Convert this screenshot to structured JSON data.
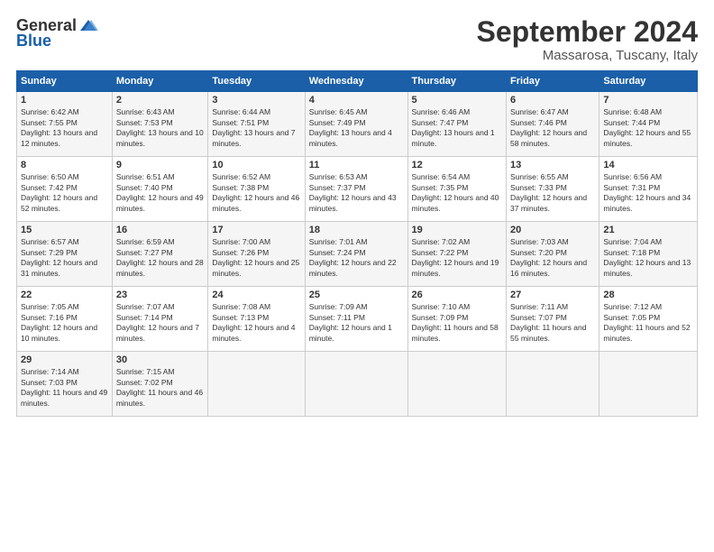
{
  "header": {
    "logo_general": "General",
    "logo_blue": "Blue",
    "month_title": "September 2024",
    "location": "Massarosa, Tuscany, Italy"
  },
  "columns": [
    "Sunday",
    "Monday",
    "Tuesday",
    "Wednesday",
    "Thursday",
    "Friday",
    "Saturday"
  ],
  "weeks": [
    [
      {
        "day": "1",
        "sunrise": "Sunrise: 6:42 AM",
        "sunset": "Sunset: 7:55 PM",
        "daylight": "Daylight: 13 hours and 12 minutes."
      },
      {
        "day": "2",
        "sunrise": "Sunrise: 6:43 AM",
        "sunset": "Sunset: 7:53 PM",
        "daylight": "Daylight: 13 hours and 10 minutes."
      },
      {
        "day": "3",
        "sunrise": "Sunrise: 6:44 AM",
        "sunset": "Sunset: 7:51 PM",
        "daylight": "Daylight: 13 hours and 7 minutes."
      },
      {
        "day": "4",
        "sunrise": "Sunrise: 6:45 AM",
        "sunset": "Sunset: 7:49 PM",
        "daylight": "Daylight: 13 hours and 4 minutes."
      },
      {
        "day": "5",
        "sunrise": "Sunrise: 6:46 AM",
        "sunset": "Sunset: 7:47 PM",
        "daylight": "Daylight: 13 hours and 1 minute."
      },
      {
        "day": "6",
        "sunrise": "Sunrise: 6:47 AM",
        "sunset": "Sunset: 7:46 PM",
        "daylight": "Daylight: 12 hours and 58 minutes."
      },
      {
        "day": "7",
        "sunrise": "Sunrise: 6:48 AM",
        "sunset": "Sunset: 7:44 PM",
        "daylight": "Daylight: 12 hours and 55 minutes."
      }
    ],
    [
      {
        "day": "8",
        "sunrise": "Sunrise: 6:50 AM",
        "sunset": "Sunset: 7:42 PM",
        "daylight": "Daylight: 12 hours and 52 minutes."
      },
      {
        "day": "9",
        "sunrise": "Sunrise: 6:51 AM",
        "sunset": "Sunset: 7:40 PM",
        "daylight": "Daylight: 12 hours and 49 minutes."
      },
      {
        "day": "10",
        "sunrise": "Sunrise: 6:52 AM",
        "sunset": "Sunset: 7:38 PM",
        "daylight": "Daylight: 12 hours and 46 minutes."
      },
      {
        "day": "11",
        "sunrise": "Sunrise: 6:53 AM",
        "sunset": "Sunset: 7:37 PM",
        "daylight": "Daylight: 12 hours and 43 minutes."
      },
      {
        "day": "12",
        "sunrise": "Sunrise: 6:54 AM",
        "sunset": "Sunset: 7:35 PM",
        "daylight": "Daylight: 12 hours and 40 minutes."
      },
      {
        "day": "13",
        "sunrise": "Sunrise: 6:55 AM",
        "sunset": "Sunset: 7:33 PM",
        "daylight": "Daylight: 12 hours and 37 minutes."
      },
      {
        "day": "14",
        "sunrise": "Sunrise: 6:56 AM",
        "sunset": "Sunset: 7:31 PM",
        "daylight": "Daylight: 12 hours and 34 minutes."
      }
    ],
    [
      {
        "day": "15",
        "sunrise": "Sunrise: 6:57 AM",
        "sunset": "Sunset: 7:29 PM",
        "daylight": "Daylight: 12 hours and 31 minutes."
      },
      {
        "day": "16",
        "sunrise": "Sunrise: 6:59 AM",
        "sunset": "Sunset: 7:27 PM",
        "daylight": "Daylight: 12 hours and 28 minutes."
      },
      {
        "day": "17",
        "sunrise": "Sunrise: 7:00 AM",
        "sunset": "Sunset: 7:26 PM",
        "daylight": "Daylight: 12 hours and 25 minutes."
      },
      {
        "day": "18",
        "sunrise": "Sunrise: 7:01 AM",
        "sunset": "Sunset: 7:24 PM",
        "daylight": "Daylight: 12 hours and 22 minutes."
      },
      {
        "day": "19",
        "sunrise": "Sunrise: 7:02 AM",
        "sunset": "Sunset: 7:22 PM",
        "daylight": "Daylight: 12 hours and 19 minutes."
      },
      {
        "day": "20",
        "sunrise": "Sunrise: 7:03 AM",
        "sunset": "Sunset: 7:20 PM",
        "daylight": "Daylight: 12 hours and 16 minutes."
      },
      {
        "day": "21",
        "sunrise": "Sunrise: 7:04 AM",
        "sunset": "Sunset: 7:18 PM",
        "daylight": "Daylight: 12 hours and 13 minutes."
      }
    ],
    [
      {
        "day": "22",
        "sunrise": "Sunrise: 7:05 AM",
        "sunset": "Sunset: 7:16 PM",
        "daylight": "Daylight: 12 hours and 10 minutes."
      },
      {
        "day": "23",
        "sunrise": "Sunrise: 7:07 AM",
        "sunset": "Sunset: 7:14 PM",
        "daylight": "Daylight: 12 hours and 7 minutes."
      },
      {
        "day": "24",
        "sunrise": "Sunrise: 7:08 AM",
        "sunset": "Sunset: 7:13 PM",
        "daylight": "Daylight: 12 hours and 4 minutes."
      },
      {
        "day": "25",
        "sunrise": "Sunrise: 7:09 AM",
        "sunset": "Sunset: 7:11 PM",
        "daylight": "Daylight: 12 hours and 1 minute."
      },
      {
        "day": "26",
        "sunrise": "Sunrise: 7:10 AM",
        "sunset": "Sunset: 7:09 PM",
        "daylight": "Daylight: 11 hours and 58 minutes."
      },
      {
        "day": "27",
        "sunrise": "Sunrise: 7:11 AM",
        "sunset": "Sunset: 7:07 PM",
        "daylight": "Daylight: 11 hours and 55 minutes."
      },
      {
        "day": "28",
        "sunrise": "Sunrise: 7:12 AM",
        "sunset": "Sunset: 7:05 PM",
        "daylight": "Daylight: 11 hours and 52 minutes."
      }
    ],
    [
      {
        "day": "29",
        "sunrise": "Sunrise: 7:14 AM",
        "sunset": "Sunset: 7:03 PM",
        "daylight": "Daylight: 11 hours and 49 minutes."
      },
      {
        "day": "30",
        "sunrise": "Sunrise: 7:15 AM",
        "sunset": "Sunset: 7:02 PM",
        "daylight": "Daylight: 11 hours and 46 minutes."
      },
      null,
      null,
      null,
      null,
      null
    ]
  ]
}
